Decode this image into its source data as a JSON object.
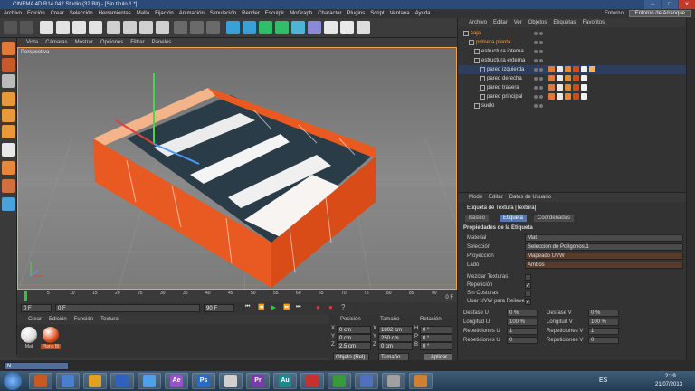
{
  "window": {
    "title": "CINEMA 4D R14.042 Studio (32 Bit) - [Sin título 1 *]"
  },
  "menubar": [
    "Archivo",
    "Edición",
    "Crear",
    "Selección",
    "Herramientas",
    "Malla",
    "Fijación",
    "Animación",
    "Simulación",
    "Render",
    "Esculpir",
    "MoGraph",
    "Character",
    "Plugins",
    "Script",
    "Ventana",
    "Ayuda"
  ],
  "entorno": {
    "label": "Entorno:",
    "value": "Entorno de Arranque"
  },
  "viewport": {
    "menu": [
      "Vista",
      "Cámaras",
      "Mostrar",
      "Opciones",
      "Filtrar",
      "Paneles"
    ],
    "label": "Perspectiva"
  },
  "timeline": {
    "ticks": [
      "0",
      "5",
      "10",
      "15",
      "20",
      "25",
      "30",
      "35",
      "40",
      "45",
      "50",
      "55",
      "60",
      "65",
      "70",
      "75",
      "80",
      "85",
      "90"
    ],
    "current_frame": "0 F",
    "end_label": "0 F"
  },
  "transport": {
    "start": "0 F",
    "min": "0 F",
    "max": "90 F",
    "end": "90 F"
  },
  "material_manager": {
    "menu": [
      "Crear",
      "Edición",
      "Función",
      "Textura"
    ],
    "materials": [
      {
        "name": "Mat",
        "color": "#d9d9d9"
      },
      {
        "name": "Plano Bl",
        "color": "#e04a1a"
      }
    ]
  },
  "coordinates": {
    "headers": [
      "Posición",
      "Tamaño",
      "Rotación"
    ],
    "rows": [
      {
        "axis": "X",
        "pos": "0 cm",
        "size_axis": "X",
        "size": "1802 cm",
        "rot_axis": "H",
        "rot": "0 °"
      },
      {
        "axis": "Y",
        "pos": "0 cm",
        "size_axis": "Y",
        "size": "250 cm",
        "rot_axis": "P",
        "rot": "0 °"
      },
      {
        "axis": "Z",
        "pos": "2.5 cm",
        "size_axis": "Z",
        "size": "0 cm",
        "rot_axis": "B",
        "rot": "0 °"
      }
    ],
    "mode": "Objeto (Rel)",
    "size_mode": "Tamaño",
    "apply": "Aplicar"
  },
  "object_manager": {
    "menu": [
      "Archivo",
      "Editar",
      "Ver",
      "Objetos",
      "Etiquetas",
      "Favoritos"
    ],
    "objects": [
      {
        "name": "caja",
        "indent": 0,
        "style": "orange"
      },
      {
        "name": "primera planta",
        "indent": 1,
        "style": "orange"
      },
      {
        "name": "estructura interna",
        "indent": 2,
        "style": "normal"
      },
      {
        "name": "estructura externa",
        "indent": 2,
        "style": "normal"
      },
      {
        "name": "pared izquierda",
        "indent": 3,
        "style": "selected"
      },
      {
        "name": "pared derecha",
        "indent": 3,
        "style": "normal"
      },
      {
        "name": "pared trasera",
        "indent": 3,
        "style": "normal"
      },
      {
        "name": "pared principal",
        "indent": 3,
        "style": "normal"
      },
      {
        "name": "suelo",
        "indent": 2,
        "style": "normal"
      }
    ]
  },
  "attribute_manager": {
    "menu": [
      "Modo",
      "Editar",
      "Datos de Usuario"
    ],
    "title": "Etiqueta de Textura [Textura]",
    "tabs": [
      "Básico",
      "Etiqueta",
      "Coordenadas"
    ],
    "active_tab": "Etiqueta",
    "section": "Propiedades de la Etiqueta",
    "fields": [
      {
        "label": "Material",
        "value": "Mat"
      },
      {
        "label": "Selección",
        "value": "Selección de Polígonos.1"
      },
      {
        "label": "Proyección",
        "value": "Mapeado UVW"
      },
      {
        "label": "Lado",
        "value": "Ambos"
      }
    ],
    "checks": [
      {
        "label": "Mezclar Texturas",
        "value": ""
      },
      {
        "label": "Repetición",
        "value": "✓"
      },
      {
        "label": "Sin Costuras",
        "value": ""
      },
      {
        "label": "Usar UVW para Relieve",
        "value": "✓"
      }
    ],
    "numeric": [
      {
        "label": "Desfase U",
        "value": "0 %",
        "label2": "Desfase V",
        "value2": "0 %"
      },
      {
        "label": "Longitud U",
        "value": "100 %",
        "label2": "Longitud V",
        "value2": "100 %"
      },
      {
        "label": "Repeticiones U",
        "value": "1",
        "label2": "Repeticiones V",
        "value2": "1"
      },
      {
        "label": "Repeticiones U",
        "value": "0",
        "label2": "Repeticiones V",
        "value2": "0"
      }
    ]
  },
  "statusbar": {
    "mini_window": "N"
  },
  "taskbar": {
    "apps": [
      "",
      "",
      "",
      "",
      "",
      "Ae",
      "Ps",
      "",
      "Pr",
      "Au",
      "",
      "",
      "",
      "",
      ""
    ],
    "lang": "ES",
    "time": "2:19",
    "date": "21/07/2013"
  }
}
